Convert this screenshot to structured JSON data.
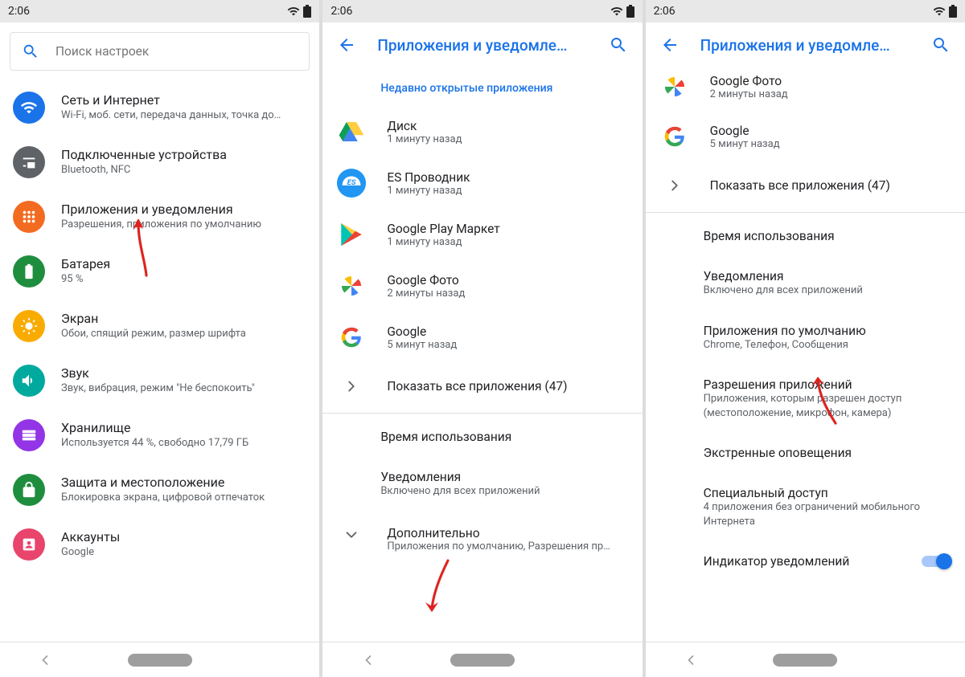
{
  "status": {
    "time": "2:06"
  },
  "screen1": {
    "search_placeholder": "Поиск настроек",
    "items": [
      {
        "title": "Сеть и Интернет",
        "sub": "Wi-Fi, моб. сети, передача данных, точка до…",
        "color": "#1A73E8",
        "icon": "wifi"
      },
      {
        "title": "Подключенные устройства",
        "sub": "Bluetooth, NFC",
        "color": "#5f6368",
        "icon": "devices"
      },
      {
        "title": "Приложения и уведомления",
        "sub": "Разрешения, приложения по умолчанию",
        "color": "#F36B21",
        "icon": "apps"
      },
      {
        "title": "Батарея",
        "sub": "95 %",
        "color": "#1E8E3E",
        "icon": "battery"
      },
      {
        "title": "Экран",
        "sub": "Обои, спящий режим, размер шрифта",
        "color": "#F9AB00",
        "icon": "display"
      },
      {
        "title": "Звук",
        "sub": "Звук, вибрация, режим \"Не беспокоить\"",
        "color": "#00A99D",
        "icon": "sound"
      },
      {
        "title": "Хранилище",
        "sub": "Используется 44 %, свободно 17,79 ГБ",
        "color": "#9334E6",
        "icon": "storage"
      },
      {
        "title": "Защита и местоположение",
        "sub": "Блокировка экрана, цифровой отпечаток",
        "color": "#1E8E3E",
        "icon": "lock"
      },
      {
        "title": "Аккаунты",
        "sub": "Google",
        "color": "#E8446C",
        "icon": "account"
      }
    ]
  },
  "screen2": {
    "title": "Приложения и уведомле…",
    "recent_label": "Недавно открытые приложения",
    "apps": [
      {
        "title": "Диск",
        "sub": "1 минуту назад",
        "icon": "drive"
      },
      {
        "title": "ES Проводник",
        "sub": "1 минуту назад",
        "icon": "es"
      },
      {
        "title": "Google Play Маркет",
        "sub": "1 минуту назад",
        "icon": "play"
      },
      {
        "title": "Google Фото",
        "sub": "2 минуты назад",
        "icon": "photos"
      },
      {
        "title": "Google",
        "sub": "5 минут назад",
        "icon": "google"
      }
    ],
    "show_all": "Показать все приложения (47)",
    "section": [
      {
        "title": "Время использования",
        "sub": ""
      },
      {
        "title": "Уведомления",
        "sub": "Включено для всех приложений"
      }
    ],
    "advanced_title": "Дополнительно",
    "advanced_sub": "Приложения по умолчанию, Разрешения пр…"
  },
  "screen3": {
    "title": "Приложения и уведомле…",
    "cutoff": {
      "title": "Google Фото",
      "sub": "2 минуты назад",
      "icon": "photos"
    },
    "apps": [
      {
        "title": "Google",
        "sub": "5 минут назад",
        "icon": "google"
      }
    ],
    "show_all": "Показать все приложения (47)",
    "section": [
      {
        "title": "Время использования",
        "sub": ""
      },
      {
        "title": "Уведомления",
        "sub": "Включено для всех приложений"
      },
      {
        "title": "Приложения по умолчанию",
        "sub": "Chrome, Телефон, Сообщения"
      },
      {
        "title": "Разрешения приложений",
        "sub": "Приложения, которым разрешен доступ (местоположение, микрофон, камера)"
      },
      {
        "title": "Экстренные оповещения",
        "sub": ""
      },
      {
        "title": "Специальный доступ",
        "sub": "4 приложения без ограничений мобильного Интернета"
      }
    ],
    "switch_label": "Индикатор уведомлений"
  }
}
